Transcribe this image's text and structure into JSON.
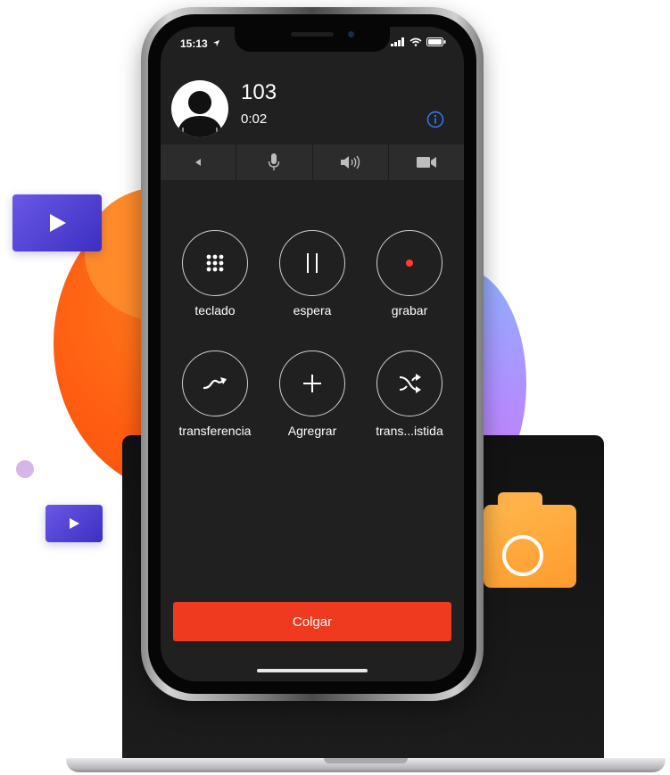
{
  "status_bar": {
    "time": "15:13"
  },
  "call": {
    "number": "103",
    "duration": "0:02"
  },
  "controls": [
    {
      "icon": "back-arrow-icon"
    },
    {
      "icon": "microphone-icon"
    },
    {
      "icon": "speaker-icon"
    },
    {
      "icon": "video-camera-icon"
    }
  ],
  "actions": [
    {
      "label": "teclado",
      "icon": "keypad-icon"
    },
    {
      "label": "espera",
      "icon": "pause-icon"
    },
    {
      "label": "grabar",
      "icon": "record-icon"
    },
    {
      "label": "transferencia",
      "icon": "transfer-icon"
    },
    {
      "label": "Agregrar",
      "icon": "add-icon"
    },
    {
      "label": "trans...istida",
      "icon": "attended-transfer-icon"
    }
  ],
  "hangup_label": "Colgar",
  "colors": {
    "hangup": "#ef3a1f",
    "record_dot": "#ff3b30",
    "info": "#3a7bff",
    "screen_bg": "#202020"
  }
}
